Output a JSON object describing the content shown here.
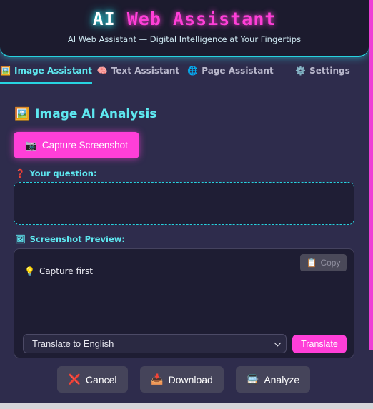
{
  "header": {
    "title_part1": "AI",
    "title_part2": "Web Assistant",
    "subtitle": "AI Web Assistant — Digital Intelligence at Your Fingertips"
  },
  "tabs": [
    {
      "icon": "🖼️",
      "label": "Image Assistant",
      "active": true
    },
    {
      "icon": "🧠",
      "label": "Text Assistant",
      "active": false
    },
    {
      "icon": "🌐",
      "label": "Page Assistant",
      "active": false
    },
    {
      "icon": "⚙️",
      "label": "Settings",
      "active": false
    }
  ],
  "main": {
    "section_icon": "🖼️",
    "section_title": "Image AI Analysis",
    "capture_icon": "📷",
    "capture_label": "Capture Screenshot",
    "question_icon": "❓",
    "question_label": "Your question:",
    "question_value": "",
    "preview_icon": "🖼",
    "preview_label": "Screenshot Preview:",
    "copy_icon": "📋",
    "copy_label": "Copy",
    "hint_icon": "💡",
    "hint_text": "Capture first",
    "translate_select": "Translate to English",
    "translate_label": "Translate"
  },
  "actions": {
    "cancel_icon": "❌",
    "cancel_label": "Cancel",
    "download_icon": "📥",
    "download_label": "Download",
    "analyze_icon": "🚍",
    "analyze_label": "Analyze"
  },
  "colors": {
    "accent_cyan": "#27d3e0",
    "accent_pink": "#ff3fd8",
    "background": "#2e2c4c"
  }
}
